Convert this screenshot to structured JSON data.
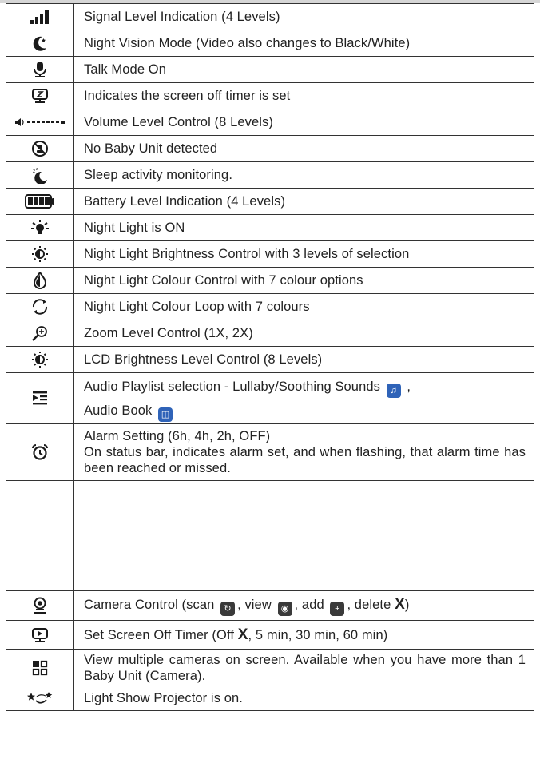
{
  "rows": [
    {
      "icon": "signal-level-icon",
      "text": "Signal Level Indication (4 Levels)"
    },
    {
      "icon": "night-vision-moon-icon",
      "text": "Night Vision Mode (Video also changes to Black/White)"
    },
    {
      "icon": "microphone-icon",
      "text": "Talk Mode On"
    },
    {
      "icon": "screen-off-timer-icon",
      "text": "Indicates the screen off timer is set"
    },
    {
      "icon": "volume-level-icon",
      "text": "Volume Level Control (8 Levels)"
    },
    {
      "icon": "no-baby-unit-icon",
      "text": "No Baby Unit detected"
    },
    {
      "icon": "sleep-activity-icon",
      "text": "Sleep activity monitoring."
    },
    {
      "icon": "battery-level-icon",
      "text": "Battery Level Indication (4 Levels)"
    },
    {
      "icon": "night-light-bulb-icon",
      "text": "Night Light is ON"
    },
    {
      "icon": "brightness-icon",
      "text": "Night Light Brightness Control with 3 levels of selection"
    },
    {
      "icon": "colour-drop-icon",
      "text": "Night Light Colour Control with 7 colour options"
    },
    {
      "icon": "colour-loop-icon",
      "text": "Night Light Colour Loop with 7 colours"
    },
    {
      "icon": "zoom-icon",
      "text": "Zoom Level Control (1X, 2X)"
    },
    {
      "icon": "lcd-brightness-icon",
      "text": "LCD Brightness Level Control (8 Levels)"
    }
  ],
  "playlist": {
    "icon": "playlist-icon",
    "line1": "Audio Playlist selection - Lullaby/Soothing Sounds",
    "line1_end": ",",
    "line2": "Audio Book",
    "lullaby_icon": "music-note-icon",
    "book_icon": "book-icon"
  },
  "alarm": {
    "icon": "alarm-clock-icon",
    "line1": "Alarm Setting (6h, 4h, 2h, OFF)",
    "line2": "On status bar, indicates alarm set, and when flashing, that alarm time has been reached or missed."
  },
  "camera": {
    "icon": "camera-icon",
    "t1": "Camera Control (scan",
    "t2": ", view",
    "t3": ", add",
    "t4": ", delete",
    "x": "X",
    "t5": ")",
    "scan_icon": "scan-icon",
    "view_icon": "eye-icon",
    "add_icon": "plus-icon"
  },
  "timer": {
    "icon": "screen-timer-icon",
    "t1": "Set Screen Off Timer (Off",
    "x": "X",
    "t2": ", 5 min, 30 min, 60 min)"
  },
  "multi": {
    "icon": "multi-camera-grid-icon",
    "text": "View multiple cameras on screen. Available when you have more than 1 Baby Unit (Camera)."
  },
  "projector": {
    "icon": "light-show-stars-icon",
    "text": "Light Show Projector is on."
  },
  "colors": {
    "border": "#333333",
    "icon": "#1a1a1a",
    "inline_icon_blue": "#2f63b8"
  }
}
